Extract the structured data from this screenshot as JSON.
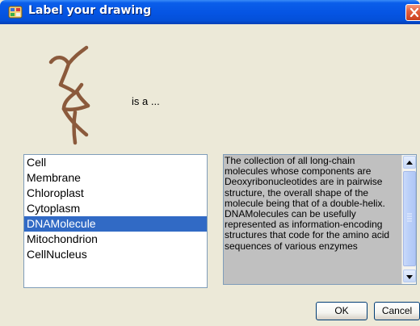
{
  "window": {
    "title": "Label your drawing",
    "title_icon": "app-palette-icon",
    "close_icon": "close-icon",
    "accent_color": "#0A5EEA"
  },
  "drawing": {
    "icon": "sketch-drawing",
    "stroke_color": "#8B5A3C"
  },
  "prompt_text": "is a ...",
  "listbox": {
    "items": [
      "Cell",
      "Membrane",
      "Chloroplast",
      "Cytoplasm",
      "DNAMolecule",
      "Mitochondrion",
      "CellNucleus"
    ],
    "selected": "DNAMolecule"
  },
  "description": {
    "text": "The collection of all long-chain molecules whose components are Deoxyribonucleotides are in pairwise structure, the overall shape of the molecule being that of a double-helix. DNAMolecules can be usefully represented as information-encoding structures that code for the amino acid sequences of various enzymes"
  },
  "buttons": {
    "ok_label": "OK",
    "cancel_label": "Cancel"
  }
}
